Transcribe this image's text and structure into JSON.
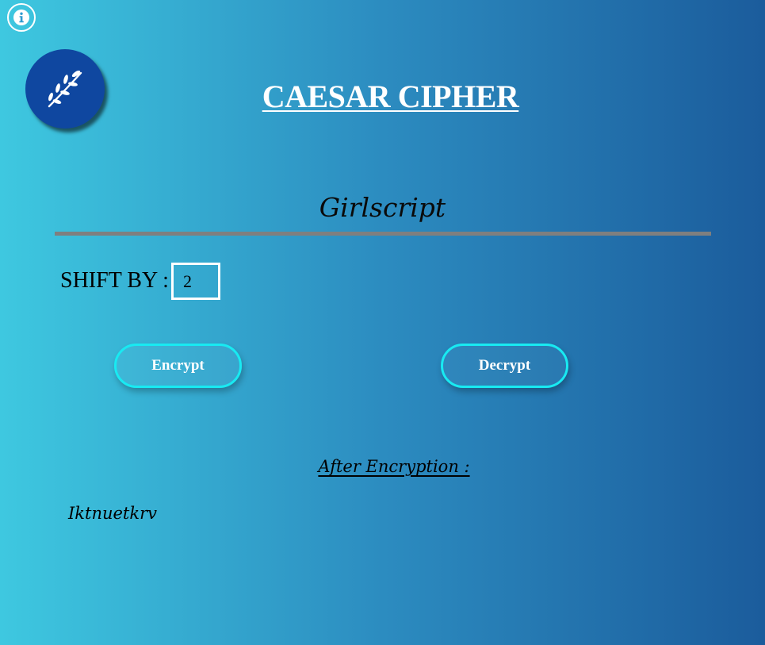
{
  "header": {
    "title": "CAESAR CIPHER",
    "subtitle": "Girlscript"
  },
  "icons": {
    "info": "info-icon",
    "logo": "leaf-branch-icon"
  },
  "shift": {
    "label": "SHIFT BY :",
    "value": "2"
  },
  "actions": {
    "encrypt_label": "Encrypt",
    "decrypt_label": "Decrypt"
  },
  "result": {
    "heading": "After Encryption :",
    "output": "Iktnuetkrv"
  },
  "colors": {
    "gradient_start": "#3ec8e0",
    "gradient_end": "#1b5c9c",
    "logo_background": "#0f47a0",
    "button_border": "#18eaf2",
    "divider": "#7f7f7f"
  }
}
